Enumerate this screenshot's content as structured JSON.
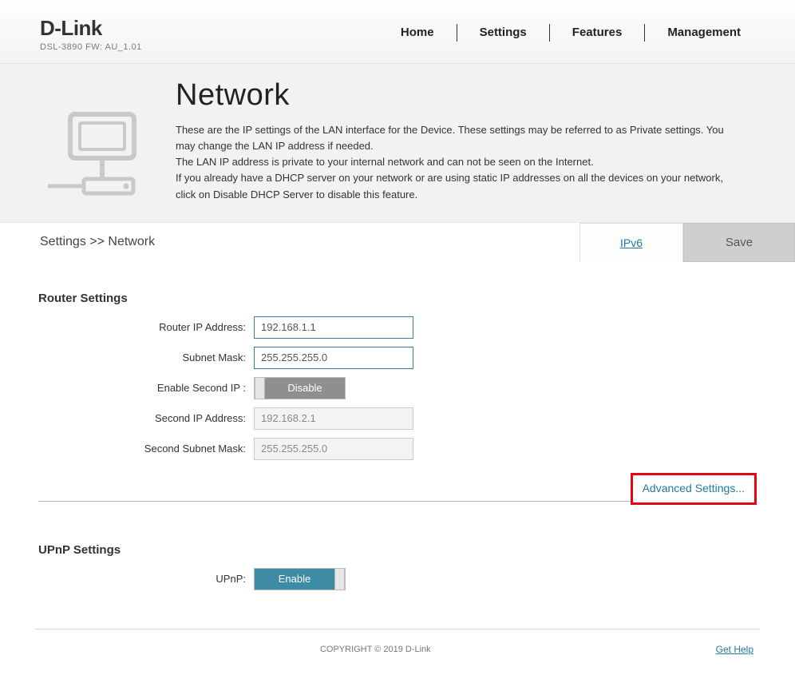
{
  "brand": {
    "name": "D-Link",
    "model": "DSL-3890   FW: AU_1.01"
  },
  "nav": {
    "home": "Home",
    "settings": "Settings",
    "features": "Features",
    "management": "Management"
  },
  "hero": {
    "title": "Network",
    "line1": "These are the IP settings of the LAN interface for the Device. These settings may be referred to as Private settings. You may change the LAN IP address if needed.",
    "line2": "The LAN IP address is private to your internal network and can not be seen on the Internet.",
    "line3": "If you already have a DHCP server on your network or are using static IP addresses on all the devices on your network, click on Disable DHCP Server to disable this feature."
  },
  "breadcrumb": "Settings >> Network",
  "tabs": {
    "ipv6": "IPv6",
    "save": "Save"
  },
  "router_settings": {
    "heading": "Router Settings",
    "labels": {
      "ip": "Router IP Address:",
      "mask": "Subnet Mask:",
      "second_toggle": "Enable Second IP :",
      "second_ip": "Second IP Address:",
      "second_mask": "Second Subnet Mask:"
    },
    "values": {
      "ip": "192.168.1.1",
      "mask": "255.255.255.0",
      "second_ip": "192.168.2.1",
      "second_mask": "255.255.255.0"
    },
    "toggle_label": "Disable"
  },
  "advanced_link": "Advanced Settings...",
  "upnp": {
    "heading": "UPnP Settings",
    "label": "UPnP:",
    "toggle_label": "Enable"
  },
  "footer": {
    "copyright": "COPYRIGHT © 2019 D-Link",
    "help": "Get Help"
  }
}
